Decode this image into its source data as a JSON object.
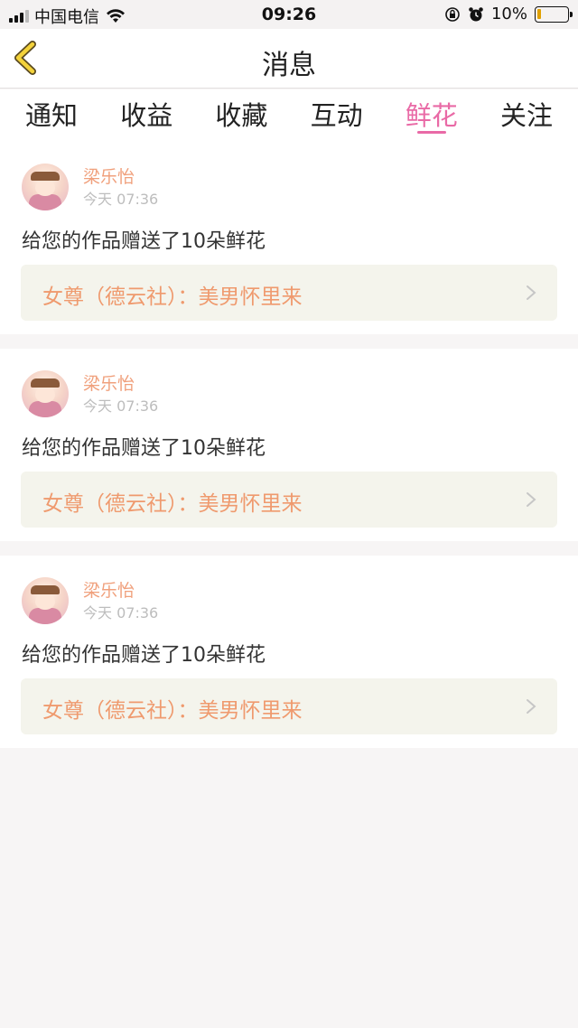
{
  "status_bar": {
    "carrier": "中国电信",
    "time": "09:26",
    "battery": "10%",
    "battery_level": 0.1
  },
  "header": {
    "title": "消息",
    "back_icon": "chevron-left-icon"
  },
  "tabs": [
    {
      "label": "通知",
      "active": false
    },
    {
      "label": "收益",
      "active": false
    },
    {
      "label": "收藏",
      "active": false
    },
    {
      "label": "互动",
      "active": false
    },
    {
      "label": "鲜花",
      "active": true
    },
    {
      "label": "关注",
      "active": false
    }
  ],
  "colors": {
    "accent_pink": "#e96aa6",
    "orange_text": "#ef9a6e",
    "card_link_bg": "#f4f4ec"
  },
  "messages": [
    {
      "user": "梁乐怡",
      "time": "今天 07:36",
      "text": "给您的作品赠送了10朵鲜花",
      "work": "女尊（德云社）：美男怀里来"
    },
    {
      "user": "梁乐怡",
      "time": "今天 07:36",
      "text": "给您的作品赠送了10朵鲜花",
      "work": "女尊（德云社）：美男怀里来"
    },
    {
      "user": "梁乐怡",
      "time": "今天 07:36",
      "text": "给您的作品赠送了10朵鲜花",
      "work": "女尊（德云社）：美男怀里来"
    }
  ]
}
